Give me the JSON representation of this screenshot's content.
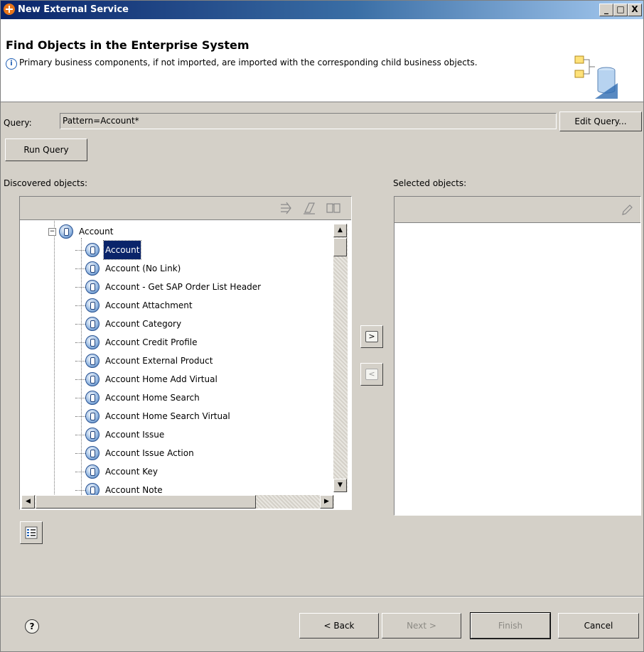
{
  "window": {
    "title": "New External Service",
    "controls": {
      "minimize": "_",
      "maximize": "□",
      "close": "X"
    }
  },
  "header": {
    "title": "Find Objects in the Enterprise System",
    "description": "Primary business components, if not imported, are imported with the corresponding child business objects."
  },
  "query": {
    "label": "Query:",
    "value": "Pattern=Account*",
    "edit_button": "Edit Query...",
    "run_button": "Run Query"
  },
  "discovered": {
    "label": "Discovered objects:",
    "root": "Account",
    "items": [
      "Account",
      "Account (No Link)",
      "Account - Get SAP Order List Header",
      "Account Attachment",
      "Account Category",
      "Account Credit Profile",
      "Account External Product",
      "Account Home Add Virtual",
      "Account Home Search",
      "Account Home Search Virtual",
      "Account Issue",
      "Account Issue Action",
      "Account Key",
      "Account Note"
    ],
    "selected_index": 0
  },
  "selected": {
    "label": "Selected objects:"
  },
  "transfer": {
    "add": ">",
    "remove": "<"
  },
  "footer": {
    "back": "< Back",
    "next": "Next >",
    "finish": "Finish",
    "cancel": "Cancel"
  }
}
